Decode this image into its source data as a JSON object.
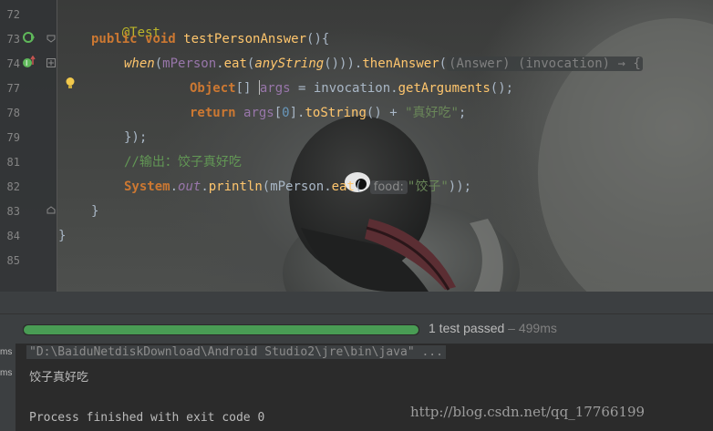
{
  "editor": {
    "line_numbers": [
      "72",
      "73",
      "74",
      "77",
      "78",
      "79",
      "81",
      "82",
      "83",
      "84",
      "85"
    ],
    "lines": {
      "l72": {
        "annotation": "@Test"
      },
      "l73": {
        "kw_public": "public",
        "kw_void": "void",
        "method": "testPersonAnswer",
        "tail": "(){"
      },
      "l74": {
        "when": "when",
        "p1": "(",
        "mPerson": "mPerson",
        "dot1": ".",
        "eat": "eat",
        "p2": "(",
        "anyString": "anyString",
        "tail": "())).",
        "thenAnswer": "thenAnswer",
        "p3": "(",
        "fold_hint": "(Answer) (invocation) → {"
      },
      "l77": {
        "type": "Object",
        "brackets": "[] ",
        "args": "args",
        "eq": " = invocation.",
        "getArguments": "getArguments",
        "tail": "();"
      },
      "l78": {
        "kw_return": "return",
        "args": "args",
        "br_open": "[",
        "zero": "0",
        "br_close": "].",
        "toString": "toString",
        "plus": "() + ",
        "str": "\"真好吃\"",
        "semi": ";"
      },
      "l79": {
        "text": "});"
      },
      "l81": {
        "comment": "//输出：饺子真好吃"
      },
      "l82": {
        "system": "System",
        "dot1": ".",
        "out": "out",
        "dot2": ".",
        "println": "println",
        "p1": "(mPerson.",
        "eat": "eat",
        "p2": "( ",
        "param_hint": "food:",
        "str": "\"饺子\"",
        "tail": "));"
      },
      "l83": {
        "text": "}"
      },
      "l84": {
        "text": "}"
      }
    },
    "gutter_icons": [
      "run-test-icon",
      "override-marker-icon",
      "fold-icon",
      "lightbulb-icon"
    ]
  },
  "test_runner": {
    "progress": 1.0,
    "status": "1 test passed",
    "time": " – 499ms",
    "progress_color": "#499c54"
  },
  "side_tabs": [
    "ms",
    "ms"
  ],
  "console": {
    "command": "\"D:\\BaiduNetdiskDownload\\Android Studio2\\jre\\bin\\java\" ...",
    "output": "饺子真好吃",
    "exit": "Process finished with exit code 0"
  },
  "watermark": "http://blog.csdn.net/qq_17766199"
}
